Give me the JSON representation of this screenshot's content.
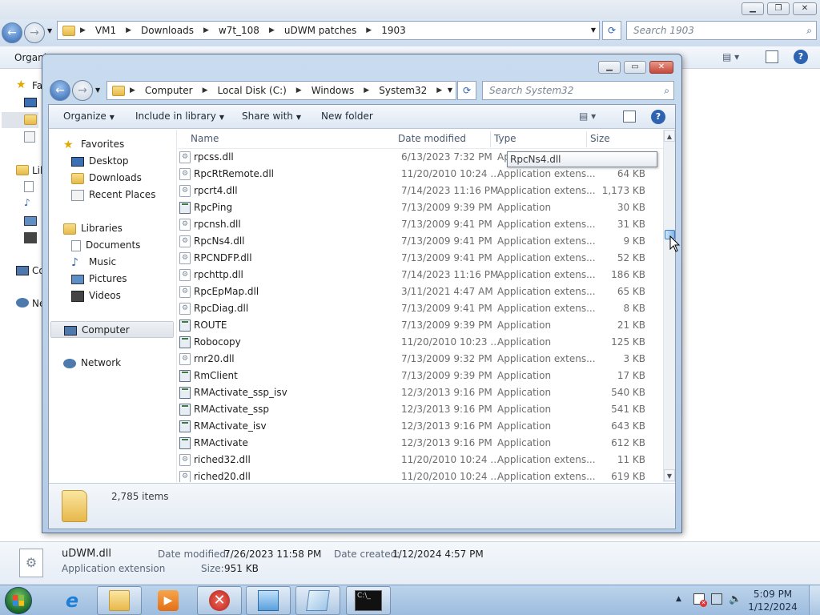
{
  "background_window": {
    "breadcrumb": [
      "VM1",
      "Downloads",
      "w7t_108",
      "uDWM patches",
      "1903"
    ],
    "search_placeholder": "Search 1903",
    "toolbar_organize": "Organi",
    "nav_fragments": [
      "Fa",
      "Lil",
      "Co",
      "Ne"
    ],
    "details": {
      "file_name": "uDWM.dll",
      "file_type": "Application extension",
      "date_modified_label": "Date modified:",
      "date_modified": "7/26/2023 11:58 PM",
      "date_created_label": "Date created:",
      "date_created": "1/12/2024 4:57 PM",
      "size_label": "Size:",
      "size": "951 KB"
    }
  },
  "window": {
    "breadcrumb": [
      "Computer",
      "Local Disk (C:)",
      "Windows",
      "System32"
    ],
    "search_placeholder": "Search System32",
    "toolbar": {
      "organize": "Organize",
      "include_in_library": "Include in library",
      "share_with": "Share with",
      "new_folder": "New folder"
    },
    "nav": {
      "favorites": "Favorites",
      "desktop": "Desktop",
      "downloads": "Downloads",
      "recent_places": "Recent Places",
      "libraries": "Libraries",
      "documents": "Documents",
      "music": "Music",
      "pictures": "Pictures",
      "videos": "Videos",
      "computer": "Computer",
      "network": "Network"
    },
    "columns": {
      "name": "Name",
      "date_modified": "Date modified",
      "type": "Type",
      "size": "Size"
    },
    "files": [
      {
        "name": "rpcss.dll",
        "date": "6/13/2023 7:32 PM",
        "type": "Ap",
        "size": "",
        "icon": "dll"
      },
      {
        "name": "RpcRtRemote.dll",
        "date": "11/20/2010 10:24 ...",
        "type": "Application extens...",
        "size": "64 KB",
        "icon": "dll"
      },
      {
        "name": "rpcrt4.dll",
        "date": "7/14/2023 11:16 PM",
        "type": "Application extens...",
        "size": "1,173 KB",
        "icon": "dll"
      },
      {
        "name": "RpcPing",
        "date": "7/13/2009 9:39 PM",
        "type": "Application",
        "size": "30 KB",
        "icon": "exe"
      },
      {
        "name": "rpcnsh.dll",
        "date": "7/13/2009 9:41 PM",
        "type": "Application extens...",
        "size": "31 KB",
        "icon": "dll"
      },
      {
        "name": "RpcNs4.dll",
        "date": "7/13/2009 9:41 PM",
        "type": "Application extens...",
        "size": "9 KB",
        "icon": "dll"
      },
      {
        "name": "RPCNDFP.dll",
        "date": "7/13/2009 9:41 PM",
        "type": "Application extens...",
        "size": "52 KB",
        "icon": "dll"
      },
      {
        "name": "rpchttp.dll",
        "date": "7/14/2023 11:16 PM",
        "type": "Application extens...",
        "size": "186 KB",
        "icon": "dll"
      },
      {
        "name": "RpcEpMap.dll",
        "date": "3/11/2021 4:47 AM",
        "type": "Application extens...",
        "size": "65 KB",
        "icon": "dll"
      },
      {
        "name": "RpcDiag.dll",
        "date": "7/13/2009 9:41 PM",
        "type": "Application extens...",
        "size": "8 KB",
        "icon": "dll"
      },
      {
        "name": "ROUTE",
        "date": "7/13/2009 9:39 PM",
        "type": "Application",
        "size": "21 KB",
        "icon": "exe"
      },
      {
        "name": "Robocopy",
        "date": "11/20/2010 10:23 ...",
        "type": "Application",
        "size": "125 KB",
        "icon": "exe"
      },
      {
        "name": "rnr20.dll",
        "date": "7/13/2009 9:32 PM",
        "type": "Application extens...",
        "size": "3 KB",
        "icon": "dll"
      },
      {
        "name": "RmClient",
        "date": "7/13/2009 9:39 PM",
        "type": "Application",
        "size": "17 KB",
        "icon": "exe"
      },
      {
        "name": "RMActivate_ssp_isv",
        "date": "12/3/2013 9:16 PM",
        "type": "Application",
        "size": "540 KB",
        "icon": "exe"
      },
      {
        "name": "RMActivate_ssp",
        "date": "12/3/2013 9:16 PM",
        "type": "Application",
        "size": "541 KB",
        "icon": "exe"
      },
      {
        "name": "RMActivate_isv",
        "date": "12/3/2013 9:16 PM",
        "type": "Application",
        "size": "643 KB",
        "icon": "exe"
      },
      {
        "name": "RMActivate",
        "date": "12/3/2013 9:16 PM",
        "type": "Application",
        "size": "612 KB",
        "icon": "exe"
      },
      {
        "name": "riched32.dll",
        "date": "11/20/2010 10:24 ...",
        "type": "Application extens...",
        "size": "11 KB",
        "icon": "dll"
      },
      {
        "name": "riched20.dll",
        "date": "11/20/2010 10:24 ...",
        "type": "Application extens...",
        "size": "619 KB",
        "icon": "dll"
      }
    ],
    "tooltip": "RpcNs4.dll",
    "status_item_count": "2,785 items"
  },
  "taskbar": {
    "clock_time": "5:09 PM",
    "clock_date": "1/12/2024"
  }
}
